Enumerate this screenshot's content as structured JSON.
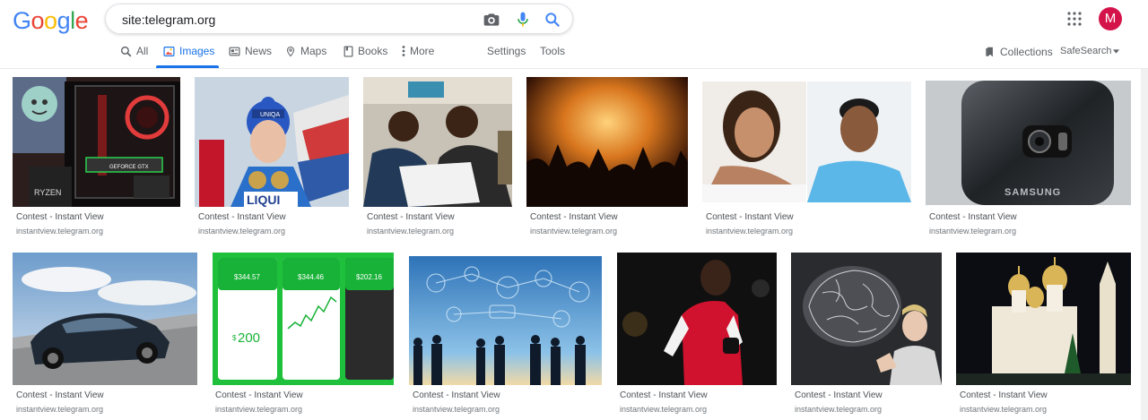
{
  "logo": {
    "letters": [
      "G",
      "o",
      "o",
      "g",
      "l",
      "e"
    ],
    "colors": [
      "#4285f4",
      "#ea4335",
      "#fbbc05",
      "#4285f4",
      "#34a853",
      "#ea4335"
    ]
  },
  "search": {
    "query": "site:telegram.org"
  },
  "account": {
    "initial": "M",
    "color": "#d5134b"
  },
  "tabs": [
    {
      "label": "All",
      "icon": "search-icon"
    },
    {
      "label": "Images",
      "icon": "image-icon",
      "active": true
    },
    {
      "label": "News",
      "icon": "news-icon"
    },
    {
      "label": "Maps",
      "icon": "map-pin-icon"
    },
    {
      "label": "Books",
      "icon": "book-icon"
    },
    {
      "label": "More",
      "icon": "more-vertical-icon"
    },
    {
      "label": "Settings"
    },
    {
      "label": "Tools"
    }
  ],
  "right_tools": {
    "collections": "Collections",
    "safesearch": "SafeSearch"
  },
  "results": [
    {
      "title": "Contest - Instant View",
      "source": "instantview.telegram.org"
    },
    {
      "title": "Contest - Instant View",
      "source": "instantview.telegram.org"
    },
    {
      "title": "Contest - Instant View",
      "source": "instantview.telegram.org"
    },
    {
      "title": "Contest - Instant View",
      "source": "instantview.telegram.org"
    },
    {
      "title": "Contest - Instant View",
      "source": "instantview.telegram.org"
    },
    {
      "title": "Contest - Instant View",
      "source": "instantview.telegram.org"
    },
    {
      "title": "Contest - Instant View",
      "source": "instantview.telegram.org"
    },
    {
      "title": "Contest - Instant View",
      "source": "instantview.telegram.org"
    },
    {
      "title": "Contest - Instant View",
      "source": "instantview.telegram.org"
    },
    {
      "title": "Contest - Instant View",
      "source": "instantview.telegram.org"
    },
    {
      "title": "Contest - Instant View",
      "source": "instantview.telegram.org"
    },
    {
      "title": "Contest - Instant View",
      "source": "instantview.telegram.org"
    }
  ],
  "image_texts": {
    "ryzen": "RYZEN",
    "geforce": "GEFORCE GTX",
    "uniqa": "UNIQA",
    "liqui": "LIQUI",
    "samsung": "SAMSUNG",
    "app_balance_1": "$344.57",
    "app_balance_2": "$344.46",
    "app_balance_3": "$202.16",
    "app_amount": "200",
    "app_currency": "$"
  }
}
